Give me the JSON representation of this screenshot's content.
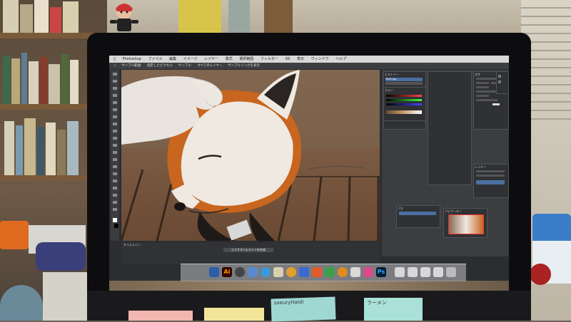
{
  "scene": "Photo of an iMac monitor on a desk showing Photoshop editing a fox photo",
  "photoshop": {
    "app_name": "Photoshop",
    "menu": [
      "Photoshop",
      "ファイル",
      "編集",
      "イメージ",
      "レイヤー",
      "書式",
      "選択範囲",
      "フィルター",
      "3D",
      "表示",
      "ウィンドウ",
      "ヘルプ"
    ],
    "options": [
      "サンプル範囲:",
      "指定したピクセル",
      "サンプル:",
      "すべてのレイヤー",
      "サンプルリングを表示"
    ],
    "timeline_label": "タイムライン",
    "timeline_button": "ビデオタイムラインを作成",
    "doc_tab": "0001.jpg",
    "panel_titles": [
      "ヒストリー",
      "カラー",
      "スウォッチ",
      "文字",
      "段落",
      "レイヤー",
      "パス",
      "ナビゲーター"
    ]
  },
  "dock": {
    "app_labels": [
      "Ai",
      "Ps"
    ]
  },
  "notes": {
    "note1": "soeuryHaidi",
    "note2": "ラーメン"
  },
  "colors": {
    "screen_bg": "#2b2d30",
    "panel_bg": "#3b3d40",
    "fox_orange": "#c8651e",
    "fox_white": "#efe9e1"
  }
}
